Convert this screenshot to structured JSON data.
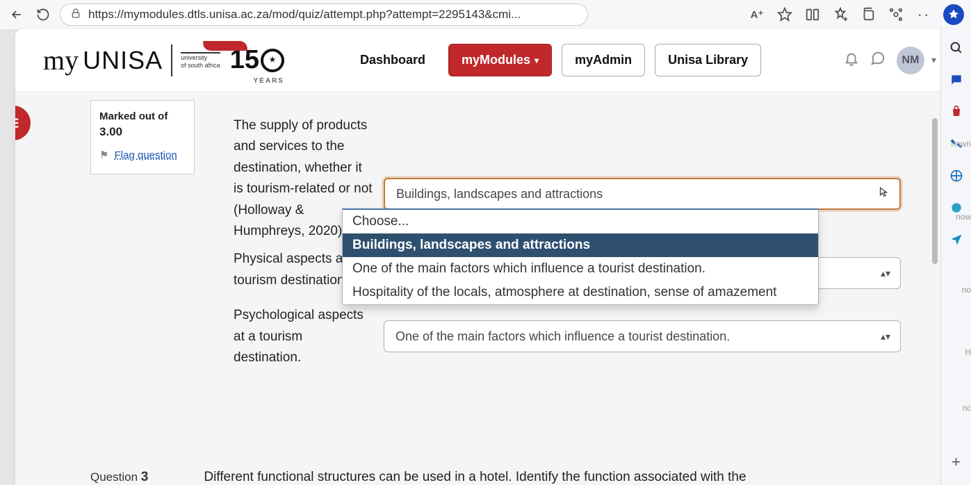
{
  "browser": {
    "url": "https://mymodules.dtls.unisa.ac.za/mod/quiz/attempt.php?attempt=2295143&cmi...",
    "read_aloud": "A⁺"
  },
  "logo": {
    "my": "my",
    "unisa": "UNISA",
    "tag1": "university",
    "tag2": "of south africa",
    "num": "15",
    "years": "YEARS"
  },
  "nav": {
    "dashboard": "Dashboard",
    "mymodules": "myModules",
    "myadmin": "myAdmin",
    "library": "Unisa Library"
  },
  "user": {
    "initials": "NM"
  },
  "qinfo": {
    "marked_label": "Marked out of",
    "max": "3.00",
    "flag": "Flag question"
  },
  "question": {
    "row1_stem": "The supply of products and services to the destination, whether it is tourism-related or not (Holloway & Humphreys, 2020).",
    "row1_value": "Buildings, landscapes and attractions",
    "row2_stem": "Physical aspects at a tourism destination.",
    "row2_value": "Hospitality of the locals, atmosphere at destination, sense of amazement",
    "row3_stem": "Psychological aspects at a tourism destination.",
    "row3_value": "One of the main factors which influence a tourist destination."
  },
  "dropdown": {
    "opt0": "Choose...",
    "opt1": "Buildings, landscapes and attractions",
    "opt2": "One of the main factors which influence a tourist destination.",
    "opt3": "Hospitality of the locals, atmosphere at destination, sense of amazement"
  },
  "q3": {
    "label_a": "Question ",
    "label_b": "3",
    "text": "Different functional structures can be used in a hotel. Identify the function associated with the"
  },
  "side_labels": {
    "a": "nown",
    "b": "now",
    "c": "no",
    "d": "H",
    "e": "nc"
  }
}
